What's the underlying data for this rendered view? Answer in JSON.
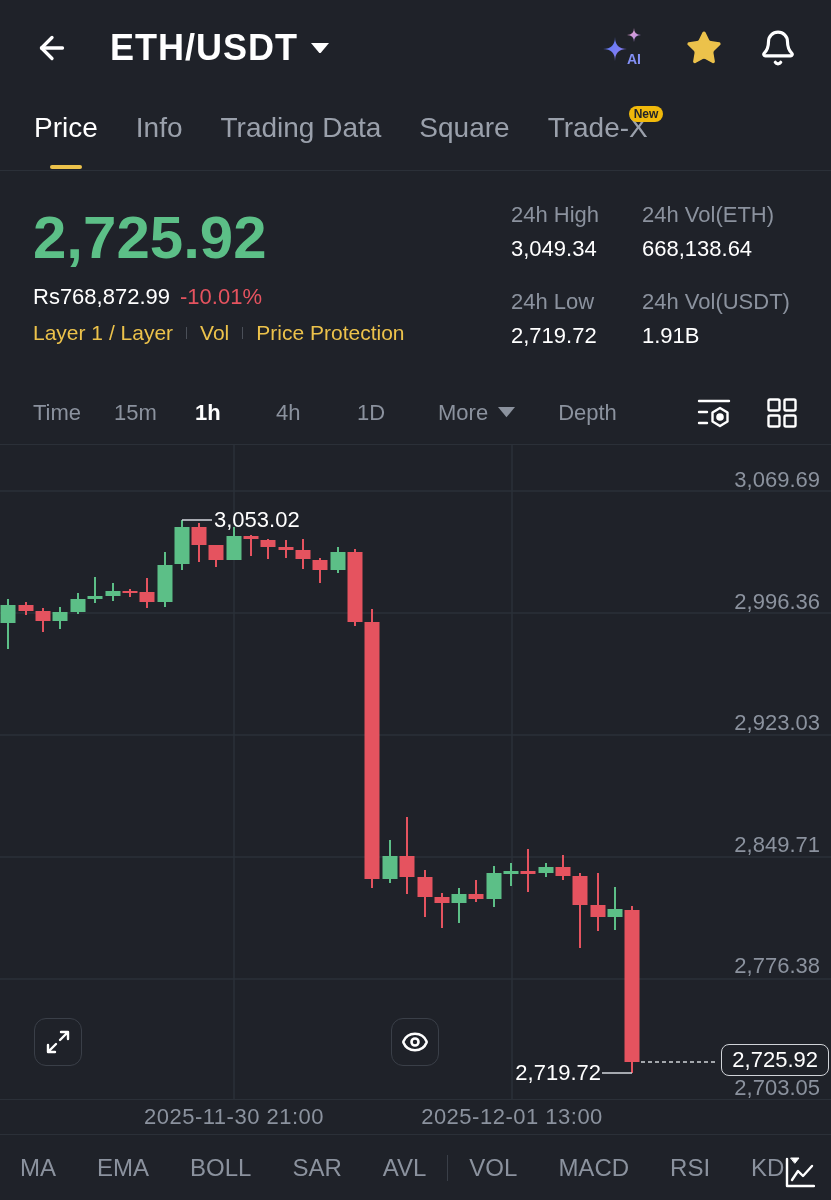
{
  "header": {
    "title": "ETH/USDT",
    "ai_label": "AI",
    "favorite": true
  },
  "tabs": [
    {
      "label": "Price",
      "selected": true
    },
    {
      "label": "Info",
      "selected": false
    },
    {
      "label": "Trading Data",
      "selected": false
    },
    {
      "label": "Square",
      "selected": false
    },
    {
      "label": "Trade-X",
      "selected": false,
      "badge": "New"
    }
  ],
  "ticker": {
    "price": "2,725.92",
    "fiat_price": "Rs768,872.99",
    "change": "-10.01%",
    "tags": [
      "Layer 1 / Layer",
      "Vol",
      "Price Protection"
    ],
    "stats": [
      {
        "label": "24h High",
        "value": "3,049.34"
      },
      {
        "label": "24h Vol(ETH)",
        "value": "668,138.64"
      },
      {
        "label": "24h Low",
        "value": "2,719.72"
      },
      {
        "label": "24h Vol(USDT)",
        "value": "1.91B"
      }
    ]
  },
  "intervals": [
    {
      "label": "Time",
      "kind": "option",
      "selected": false
    },
    {
      "label": "15m",
      "kind": "option",
      "selected": false
    },
    {
      "label": "1h",
      "kind": "option",
      "selected": true
    },
    {
      "label": "4h",
      "kind": "option",
      "selected": false
    },
    {
      "label": "1D",
      "kind": "option",
      "selected": false
    },
    {
      "label": "More",
      "kind": "dropdown",
      "selected": false
    },
    {
      "label": "Depth",
      "kind": "option",
      "selected": false
    }
  ],
  "chart": {
    "price_labels": [
      "3,069.69",
      "2,996.36",
      "2,923.03",
      "2,849.71",
      "2,776.38",
      "2,703.05"
    ],
    "time_labels": [
      "2025-11-30 21:00",
      "2025-12-01 13:00"
    ],
    "high_label": "3,053.02",
    "low_label": "2,719.72",
    "last_price": "2,725.92"
  },
  "main_indicators": [
    "MA",
    "EMA",
    "BOLL",
    "SAR",
    "AVL"
  ],
  "sub_indicators": [
    "VOL",
    "MACD",
    "RSI",
    "KD"
  ]
}
